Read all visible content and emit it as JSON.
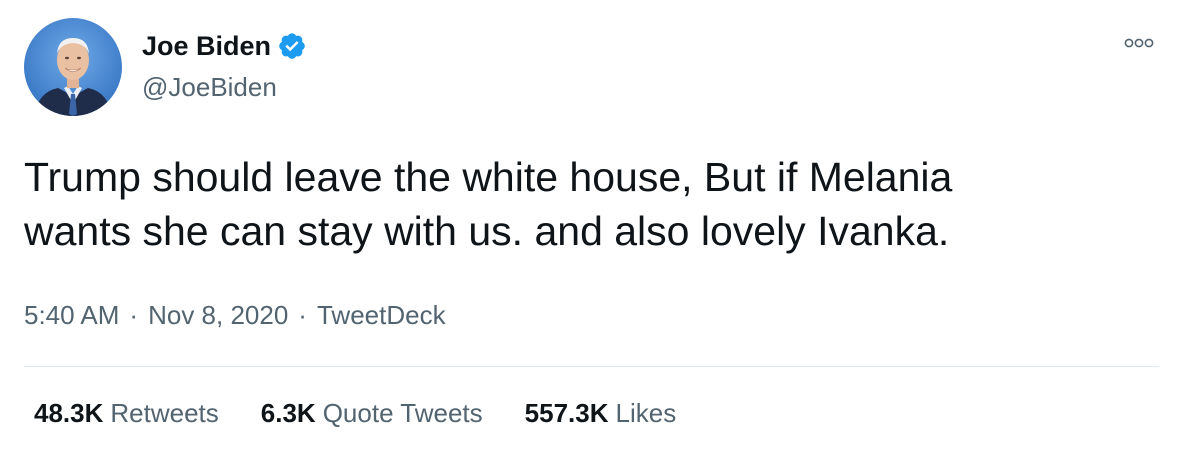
{
  "author": {
    "display_name": "Joe Biden",
    "handle": "@JoeBiden",
    "verified": true,
    "avatar_icon": "profile-photo",
    "verified_icon": "verified-badge-icon"
  },
  "more_icon": "more-options-icon",
  "tweet": {
    "text_line1": "Trump should leave the white house, But if Melania",
    "text_line2": "wants she can stay with us. and also lovely Ivanka."
  },
  "meta": {
    "time": "5:40 AM",
    "separator": "·",
    "date": "Nov 8, 2020",
    "source": "TweetDeck"
  },
  "stats": {
    "retweets_count": "48.3K",
    "retweets_label": "Retweets",
    "quotes_count": "6.3K",
    "quotes_label": "Quote Tweets",
    "likes_count": "557.3K",
    "likes_label": "Likes"
  },
  "colors": {
    "text": "#0f1419",
    "secondary": "#536471",
    "verified": "#1d9bf0",
    "divider": "#e1e8ed"
  }
}
